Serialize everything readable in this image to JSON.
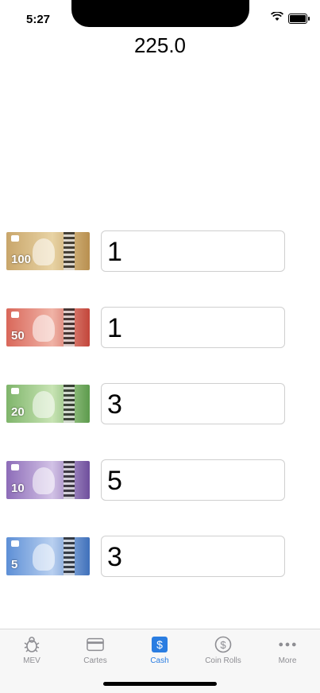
{
  "status": {
    "time": "5:27"
  },
  "total": "225.0",
  "rows": [
    {
      "denomination": "100",
      "value": "1",
      "color": "#c9a66b"
    },
    {
      "denomination": "50",
      "value": "1",
      "color": "#d9675a"
    },
    {
      "denomination": "20",
      "value": "3",
      "color": "#7fb56b"
    },
    {
      "denomination": "10",
      "value": "5",
      "color": "#8d6cb8"
    },
    {
      "denomination": "5",
      "value": "3",
      "color": "#5d8fd6"
    }
  ],
  "tabs": [
    {
      "label": "MEV",
      "icon": "bug-icon"
    },
    {
      "label": "Cartes",
      "icon": "card-icon"
    },
    {
      "label": "Cash",
      "icon": "dollar-square-icon",
      "active": true
    },
    {
      "label": "Coin Rolls",
      "icon": "dollar-circle-icon"
    },
    {
      "label": "More",
      "icon": "more-dots-icon"
    }
  ],
  "accent": "#2a7de1"
}
